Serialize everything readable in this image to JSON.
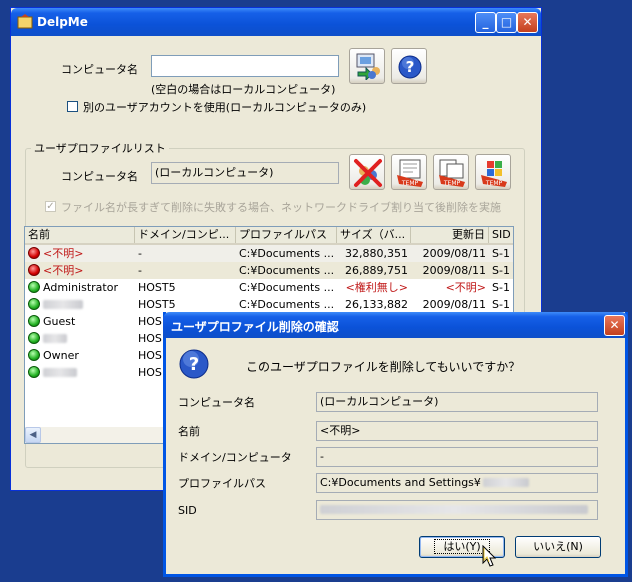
{
  "main_window": {
    "title": "DelpMe",
    "caption_buttons": [
      "minimize",
      "maximize",
      "close"
    ],
    "computer_label": "コンピュータ名",
    "computer_value": "",
    "computer_hint": "(空白の場合はローカルコンピュータ)",
    "alt_account_label": "別のユーザアカウントを使用(ローカルコンピュータのみ)",
    "alt_account_checked": false,
    "top_icons": [
      "connect-computer-icon",
      "help-icon"
    ],
    "profile_group": {
      "title": "ユーザプロファイルリスト",
      "computer_label": "コンピュータ名",
      "computer_value": "(ローカルコンピュータ)",
      "action_icons": [
        "delete-profile-icon",
        "temp-profile-icon",
        "temp-profile-copy-icon",
        "temp-profile-windows-icon"
      ],
      "temp_label": "TEMP",
      "network_drive_label": "ファイル名が長すぎて削除に失敗する場合、ネットワークドライブ割り当て後削除を実施",
      "network_drive_checked": true
    },
    "list": {
      "columns": [
        "名前",
        "ドメイン/コンピ...",
        "プロファイルパス",
        "サイズ（バ...",
        "更新日",
        "SID"
      ],
      "rows": [
        {
          "status": "red",
          "name": "<不明>",
          "domain": "-",
          "path": "C:¥Documents ...",
          "size": "32,880,351",
          "date": "2009/08/11",
          "sid": "S-1"
        },
        {
          "status": "red",
          "name": "<不明>",
          "domain": "-",
          "path": "C:¥Documents ...",
          "size": "26,889,751",
          "date": "2009/08/11",
          "sid": "S-1"
        },
        {
          "status": "green",
          "name": "Administrator",
          "domain": "HOST5",
          "path": "C:¥Documents ...",
          "size": "<権利無し>",
          "date": "<不明>",
          "sid": "S-1"
        },
        {
          "status": "green",
          "name": "",
          "domain": "HOST5",
          "path": "C:¥Documents ...",
          "size": "26,133,882",
          "date": "2009/08/11",
          "sid": "S-1"
        },
        {
          "status": "green",
          "name": "Guest",
          "domain": "HOS",
          "path": "",
          "size": "",
          "date": "",
          "sid": ""
        },
        {
          "status": "green",
          "name": "",
          "domain": "HOS",
          "path": "",
          "size": "",
          "date": "",
          "sid": ""
        },
        {
          "status": "green",
          "name": "Owner",
          "domain": "HOS",
          "path": "",
          "size": "",
          "date": "",
          "sid": ""
        },
        {
          "status": "green",
          "name": "",
          "domain": "HOS",
          "path": "",
          "size": "",
          "date": "",
          "sid": ""
        }
      ]
    }
  },
  "dialog": {
    "title": "ユーザプロファイル削除の確認",
    "question": "このユーザプロファイルを削除してもいいですか？",
    "fields": [
      {
        "label": "コンピュータ名",
        "value": "(ローカルコンピュータ)"
      },
      {
        "label": "名前",
        "value": "<不明>"
      },
      {
        "label": "ドメイン/コンピュータ",
        "value": "-"
      },
      {
        "label": "プロファイルパス",
        "value": "C:¥Documents and Settings¥"
      },
      {
        "label": "SID",
        "value": ""
      }
    ],
    "yes_label": "はい(Y)",
    "no_label": "いいえ(N)"
  },
  "colors": {
    "desktop": "#1a3d8f",
    "window_face": "#ece9d8",
    "titlebar_blue": "#0b52d8",
    "error_red": "#c01818"
  }
}
